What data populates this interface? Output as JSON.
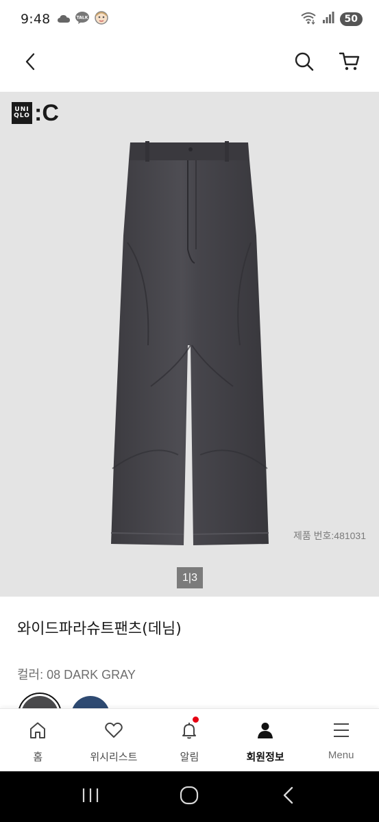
{
  "status_bar": {
    "time": "9:48",
    "battery": "50",
    "notification_icons": [
      "cloud-icon",
      "kakaotalk-icon",
      "avatar-notification-icon"
    ],
    "talk_label": "TALK"
  },
  "header": {
    "back_icon": "chevron-left-icon",
    "search_icon": "search-icon",
    "cart_icon": "cart-icon"
  },
  "product": {
    "brand_logo_lines": [
      "UNI",
      "QLO"
    ],
    "brand_suffix": ":C",
    "number_label": "제품 번호:",
    "number_value": "481031",
    "pager_text": "1|3",
    "title": "와이드파라슈트팬츠(데님)",
    "color_label": "컬러:",
    "color_value": " 08 DARK GRAY",
    "swatches": [
      {
        "name": "dark-gray",
        "color": "#4a4a4c",
        "selected": true
      },
      {
        "name": "navy",
        "color": "#2e4a72",
        "selected": false
      }
    ]
  },
  "bottom_nav": {
    "items": [
      {
        "label": "홈",
        "icon": "home-icon"
      },
      {
        "label": "위시리스트",
        "icon": "heart-icon"
      },
      {
        "label": "알림",
        "icon": "bell-icon"
      },
      {
        "label": "회원정보",
        "icon": "user-icon",
        "active": true
      },
      {
        "label": "Menu",
        "icon": "menu-icon"
      }
    ]
  },
  "colors": {
    "image_bg": "#e4e4e4",
    "accent_red": "#e60012",
    "text_dark": "#1a1a1a",
    "text_gray": "#6e6e6e"
  }
}
